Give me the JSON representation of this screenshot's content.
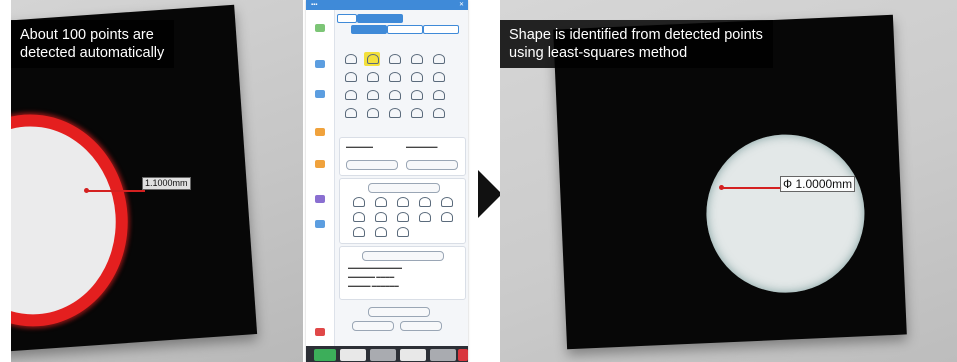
{
  "left_caption": {
    "line1": "About 100 points are",
    "line2": "detected automatically"
  },
  "right_caption": {
    "line1": "Shape is identified from detected points",
    "line2": "using least-squares method"
  },
  "left_measurement": "1.1000mm",
  "right_measurement": "Ф 1.0000mm",
  "software": {
    "titlebar_close_icon": "close-icon",
    "sidebar_items": [
      {
        "color": "#7cc576"
      },
      {
        "color": "#5c9ee0"
      },
      {
        "color": "#5c9ee0"
      },
      {
        "color": "#f0a23c"
      },
      {
        "color": "#f0a23c"
      },
      {
        "color": "#8a6fd1"
      },
      {
        "color": "#5c9ee0"
      },
      {
        "color": "#e04848"
      }
    ],
    "shape_highlight_color": "#f3e03b"
  },
  "colors": {
    "caption_bg": "#000000",
    "contour_red": "#e41f1f",
    "arrow": "#111111",
    "software_accent": "#3f8ad8"
  }
}
